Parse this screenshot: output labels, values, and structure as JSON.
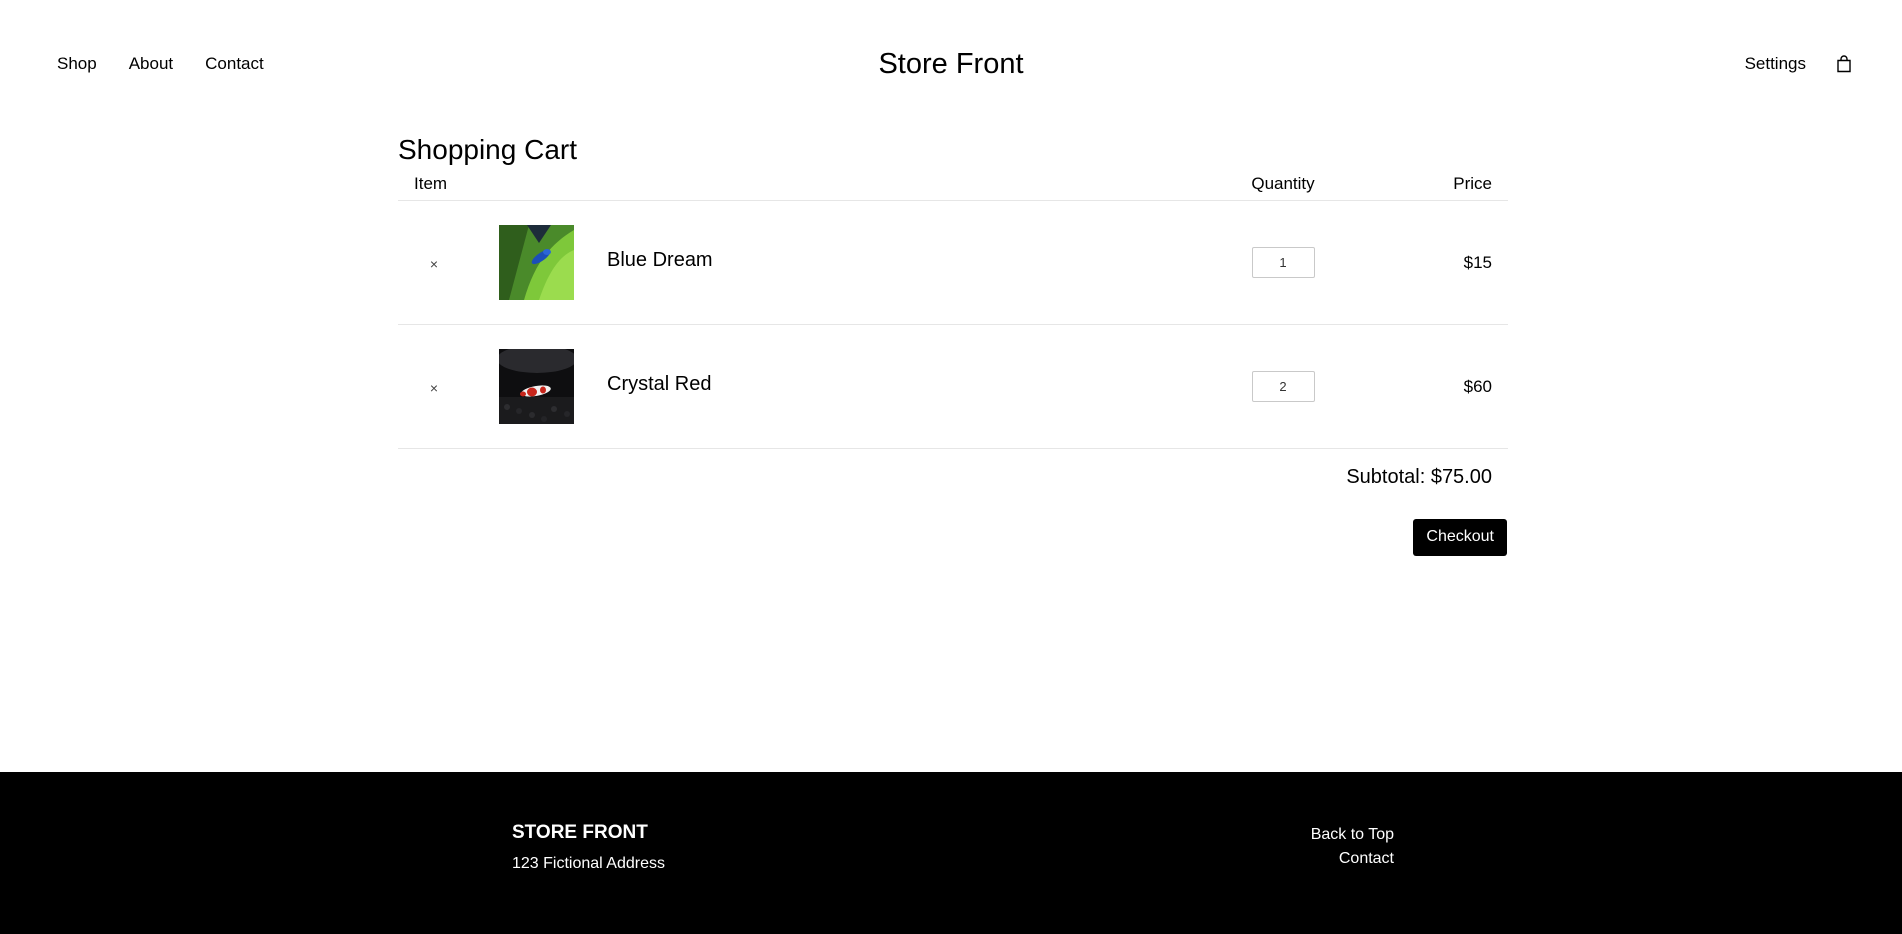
{
  "header": {
    "nav_left": [
      "Shop",
      "About",
      "Contact"
    ],
    "brand": "Store Front",
    "nav_right": {
      "settings": "Settings",
      "cart_icon": "shopping-bag-icon"
    }
  },
  "cart": {
    "title": "Shopping Cart",
    "columns": {
      "item": "Item",
      "quantity": "Quantity",
      "price": "Price"
    },
    "remove_symbol": "×",
    "items": [
      {
        "name": "Blue Dream",
        "quantity": "1",
        "price": "$15",
        "thumb": "blue shrimp on green leaf"
      },
      {
        "name": "Crystal Red",
        "quantity": "2",
        "price": "$60",
        "thumb": "red and white shrimp on dark gravel"
      }
    ],
    "subtotal": "Subtotal: $75.00",
    "checkout_label": "Checkout"
  },
  "footer": {
    "brand": "STORE FRONT",
    "address": "123 Fictional Address",
    "links": [
      "Back to Top",
      "Contact"
    ]
  },
  "colors": {
    "accent": "#000000",
    "background": "#ffffff",
    "divider": "#e6e6e6"
  }
}
